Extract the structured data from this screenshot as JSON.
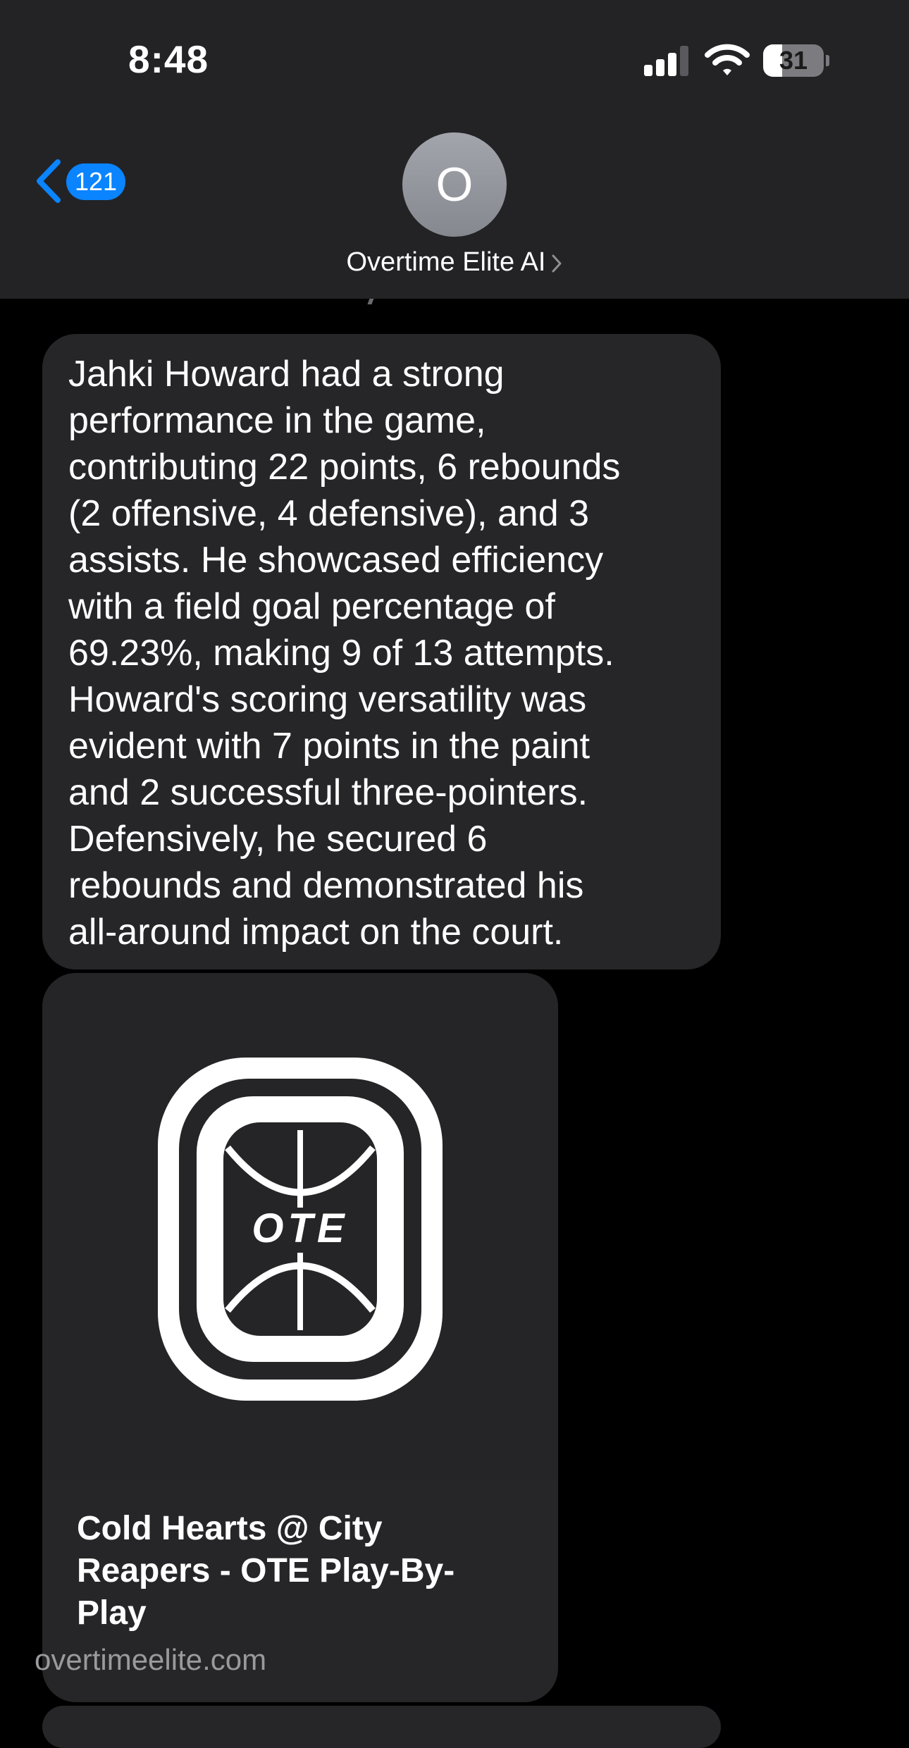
{
  "status_bar": {
    "time": "8:48",
    "battery_level": "31",
    "battery_fraction": 0.31,
    "signal_bars_active": 3
  },
  "header": {
    "unread_count": "121",
    "contact_initial": "O",
    "contact_name": "Overtime Elite AI",
    "icons": [
      "back-chevron-icon",
      "chevron-right-icon",
      "cellular-signal-icon",
      "wifi-icon",
      "battery-icon"
    ]
  },
  "conversation": {
    "message_lines": [
      "Jahki Howard had a strong",
      "performance in the game,",
      "contributing 22 points, 6 rebounds",
      "(2 offensive, 4 defensive), and 3",
      "assists. He showcased efficiency",
      "with a field goal percentage of",
      "69.23%, making 9 of 13 attempts.",
      "Howard's scoring versatility was",
      "evident with 7 points in the paint",
      "and 2 successful three-pointers.",
      "Defensively, he secured 6",
      "rebounds and demonstrated his",
      "all-around impact on the court."
    ],
    "link_preview": {
      "logo_text": "OTE",
      "title_lines": [
        "Cold Hearts @ City",
        "Reapers - OTE Play-By-",
        "Play"
      ],
      "domain": "overtimeelite.com"
    }
  },
  "colors": {
    "header_background": "#232325",
    "page_background": "#000000",
    "bubble_background": "#262628",
    "accent_blue": "#0a84ff",
    "secondary_text": "#9a9a9e",
    "avatar_gray": "#8e9097"
  }
}
